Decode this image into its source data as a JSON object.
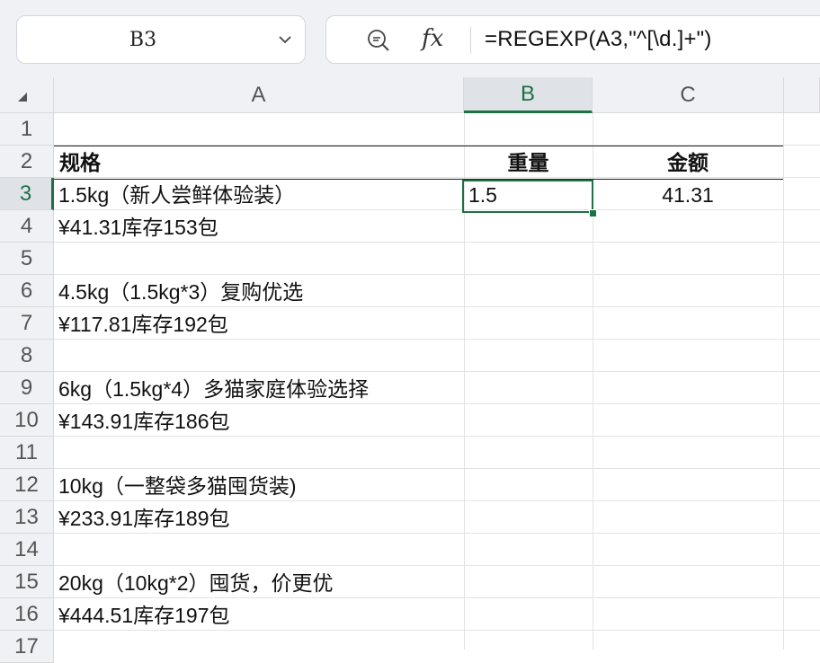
{
  "name_box": {
    "value": "B3"
  },
  "formula_bar": {
    "fx_label": "fx",
    "formula": "=REGEXP(A3,\"^[\\d.]+\")"
  },
  "columns": [
    "A",
    "B",
    "C"
  ],
  "selected_column": "B",
  "rows": [
    "1",
    "2",
    "3",
    "4",
    "5",
    "6",
    "7",
    "8",
    "9",
    "10",
    "11",
    "12",
    "13",
    "14",
    "15",
    "16",
    "17"
  ],
  "selected_row": "3",
  "cells": {
    "A2": "规格",
    "B2": "重量",
    "C2": "金额",
    "A3": "1.5kg（新人尝鲜体验装）",
    "B3": "1.5",
    "C3": "41.31",
    "A4": "¥41.31库存153包",
    "A6": "4.5kg（1.5kg*3）复购优选",
    "A7": "¥117.81库存192包",
    "A9": "6kg（1.5kg*4）多猫家庭体验选择",
    "A10": "¥143.91库存186包",
    "A12": "10kg（一整袋多猫囤货装)",
    "A13": "¥233.91库存189包",
    "A15": "20kg（10kg*2）囤货，价更优",
    "A16": "¥444.51库存197包"
  },
  "colors": {
    "accent": "#1e7145",
    "header_bg": "#f0f1f4",
    "gridline": "#e3e3e3"
  }
}
